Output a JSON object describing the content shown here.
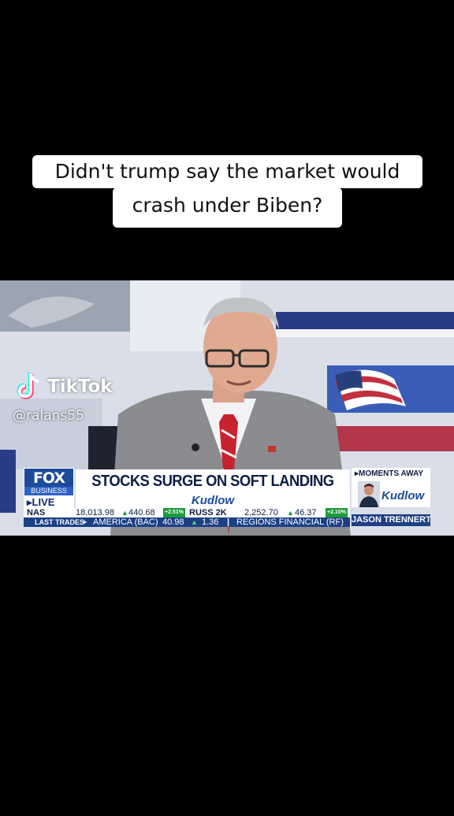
{
  "caption": {
    "line1": "Didn't trump say the market would",
    "line2": "crash under Biben?"
  },
  "tiktok": {
    "brand": "TikTok",
    "username": "@ralans55"
  },
  "broadcast": {
    "network_logo_word": "FOX",
    "network_logo_sub": "BUSINESS",
    "live_label": "▸LIVE",
    "headline": "STOCKS SURGE ON SOFT LANDING HOPES",
    "show_name": "Kudlow",
    "moments_label": "▸MOMENTS AWAY",
    "moments_show": "Kudlow",
    "guest_name": "JASON TRENNERT",
    "ticker_top": {
      "nas_label": "NAS",
      "nas_value": "18,013.98",
      "nas_change": "440.68",
      "nas_pct": "+2.51%",
      "russ_label": "RUSS 2K",
      "russ_value": "2,252.70",
      "russ_change": "46.37",
      "russ_pct": "+2.10%"
    },
    "ticker_bottom": {
      "label": "LAST TRADES",
      "item1": "AMERICA (BAC)",
      "item1_value": "40.98",
      "item1_change": "1.36",
      "item2": "REGIONS FINANCIAL (RF)"
    }
  },
  "colors": {
    "fox_blue": "#1c4b9a",
    "ticker_navy": "#1c3f86",
    "up_green": "#1a9a3a",
    "tiktok_cyan": "#25f4ee",
    "tiktok_red": "#fe2c55"
  }
}
